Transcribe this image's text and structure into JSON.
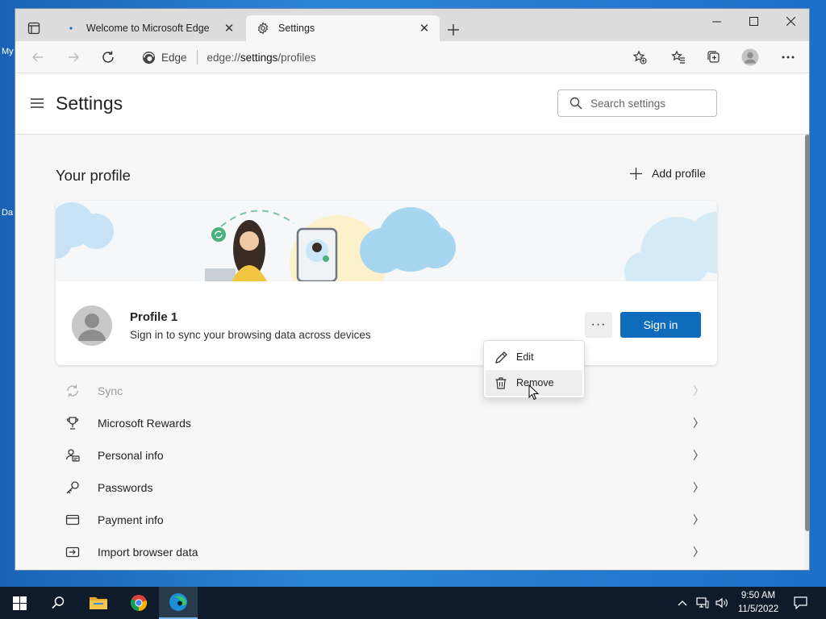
{
  "desktop": {
    "icon_labels": [
      "My",
      "Da"
    ]
  },
  "browser": {
    "tabs": [
      {
        "title": "Welcome to Microsoft Edge",
        "active": false
      },
      {
        "title": "Settings",
        "active": true
      }
    ],
    "address": {
      "brand": "Edge",
      "url_prefix": "edge://",
      "url_host": "settings",
      "url_path": "/profiles"
    }
  },
  "settings": {
    "title": "Settings",
    "search_placeholder": "Search settings",
    "section_title": "Your profile",
    "add_profile_label": "Add profile",
    "profile": {
      "name": "Profile 1",
      "description": "Sign in to sync your browsing data across devices",
      "more_label": "···",
      "sign_in_label": "Sign in"
    },
    "context_menu": [
      {
        "label": "Edit",
        "icon": "pencil-icon"
      },
      {
        "label": "Remove",
        "icon": "trash-icon",
        "hovered": true
      }
    ],
    "menu_items": [
      {
        "label": "Sync",
        "icon": "sync-icon",
        "disabled": true
      },
      {
        "label": "Microsoft Rewards",
        "icon": "trophy-icon"
      },
      {
        "label": "Personal info",
        "icon": "person-card-icon"
      },
      {
        "label": "Passwords",
        "icon": "key-icon"
      },
      {
        "label": "Payment info",
        "icon": "credit-card-icon"
      },
      {
        "label": "Import browser data",
        "icon": "import-icon"
      }
    ]
  },
  "taskbar": {
    "time": "9:50 AM",
    "date": "11/5/2022",
    "apps": [
      "start-icon",
      "search-icon",
      "file-explorer-icon",
      "chrome-icon",
      "edge-icon"
    ]
  },
  "colors": {
    "accent": "#0f6cbd",
    "taskbar": "#0f1b2a",
    "desktop": "#1b73c4"
  }
}
